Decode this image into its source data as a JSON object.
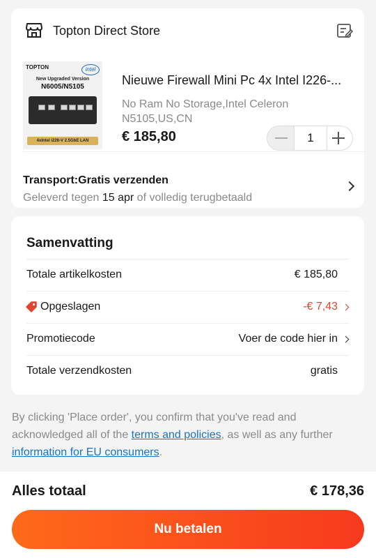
{
  "store": {
    "name": "Topton Direct Store",
    "icon": "store-icon",
    "note_icon": "note-edit-icon"
  },
  "product": {
    "image_brand": "TOPTON",
    "image_intel": "intel",
    "image_tag1": "New Upgraded Version",
    "image_tag2": "N6005/N5105",
    "image_lan": "4xIntel i226-V 2.5GbE LAN",
    "title": "Nieuwe Firewall Mini Pc 4x Intel I226-...",
    "variant": "No Ram No Storage,Intel Celeron N5105,US,CN",
    "price": "€ 185,80",
    "quantity": "1"
  },
  "shipping": {
    "title": "Transport:Gratis verzenden",
    "delivery_prefix": "Geleverd tegen ",
    "delivery_date": "15 apr",
    "delivery_suffix": " of volledig terugbetaald"
  },
  "summary": {
    "title": "Samenvatting",
    "rows": [
      {
        "label": "Totale artikelkosten",
        "value": "€ 185,80"
      },
      {
        "label": "Opgeslagen",
        "value": "-€ 7,43"
      },
      {
        "label": "Promotiecode",
        "value": "Voer de code hier in"
      },
      {
        "label": "Totale verzendkosten",
        "value": "gratis"
      }
    ]
  },
  "legal": {
    "text1": "By clicking 'Place order', you confirm that you've read and acknowledged all of the ",
    "link1": "terms and policies",
    "text2": ", as well as any further ",
    "link2": "information for EU consumers",
    "text3": "."
  },
  "footer": {
    "total_label": "Alles totaal",
    "total_value": "€ 178,36",
    "pay_button": "Nu betalen"
  },
  "colors": {
    "accent": "#f73a1d",
    "discount": "#e0442d",
    "link": "#1a73c4"
  }
}
